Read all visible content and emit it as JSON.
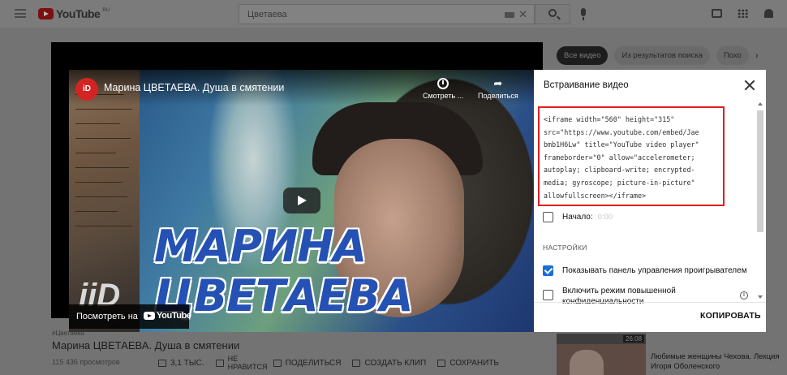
{
  "topbar": {
    "logo_text": "YouTube",
    "logo_sup": "RU",
    "search_value": "Цветаева"
  },
  "chips": [
    "Все видео",
    "Из результатов поиска",
    "Похо"
  ],
  "background_video": {
    "tag": "#Цветаева",
    "title": "Марина ЦВЕТАЕВА. Душа в смятении",
    "views": "115 436 просмотров",
    "actions": {
      "like": "3,1 ТЫС.",
      "dislike": "НЕ НРАВИТСЯ",
      "share": "ПОДЕЛИТЬСЯ",
      "clip": "СОЗДАТЬ КЛИП",
      "save": "СОХРАНИТЬ"
    }
  },
  "sidebar": {
    "badge": "26:08",
    "title": "Любимые женщины Чехова. Лекция Игоря Оболенского"
  },
  "video": {
    "channel_logo": "iD",
    "title": "Марина ЦВЕТАЕВА. Душа в смятении",
    "watch_later": "Смотреть ...",
    "share": "Поделиться",
    "overlay_line1": "МАРИНА",
    "overlay_line2": "ЦВЕТАЕВА",
    "watch_on": "Посмотреть на",
    "yt_word": "YouTube",
    "corner_logo": "iiD"
  },
  "panel": {
    "title": "Встраивание видео",
    "embed_code": "<iframe width=\"560\" height=\"315\"\nsrc=\"https://www.youtube.com/embed/Jae\nbmb1H6Lw\" title=\"YouTube video player\"\nframeborder=\"0\" allow=\"accelerometer;\nautoplay; clipboard-write; encrypted-\nmedia; gyroscope; picture-in-picture\"\nallowfullscreen></iframe>",
    "start_label": "Начало:",
    "start_value": "0:00",
    "settings_label": "НАСТРОЙКИ",
    "show_controls": "Показывать панель управления проигрывателем",
    "privacy_mode": "Включить режим повышенной конфиденциальности",
    "copy_button": "КОПИРОВАТЬ"
  },
  "colors": {
    "highlight_border": "#e01e1e",
    "checkbox_checked": "#1a6ed8"
  }
}
